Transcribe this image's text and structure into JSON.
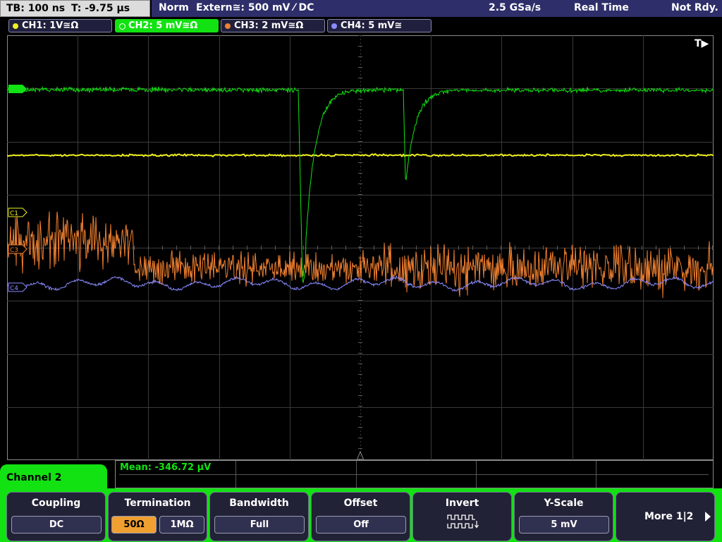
{
  "status": {
    "timebase": "TB: 100 ns",
    "trigger_time": "T: -9.75 µs",
    "mode": "Norm",
    "trigger_source": "Extern≅: 500 mV ⁄ DC",
    "sample_rate": "2.5 GSa/s",
    "acq_mode": "Real Time",
    "ready_state": "Not Rdy."
  },
  "channels": [
    {
      "label": "CH1: 1V≅Ω",
      "color": "#f0f020"
    },
    {
      "label": "CH2: 5 mV≅Ω",
      "color": "#12e212"
    },
    {
      "label": "CH3: 2 mV≅Ω",
      "color": "#f08030"
    },
    {
      "label": "CH4: 5 mV≅",
      "color": "#8a8aff"
    }
  ],
  "markers": {
    "c1": "C1",
    "c3": "C3",
    "c4": "C4",
    "trigger": "T▶"
  },
  "measurement": {
    "label": "Mean: -346.72 µV"
  },
  "menu": {
    "title": "Channel 2",
    "coupling": {
      "title": "Coupling",
      "value": "DC"
    },
    "termination": {
      "title": "Termination",
      "opt1": "50Ω",
      "opt2": "1MΩ"
    },
    "bandwidth": {
      "title": "Bandwidth",
      "value": "Full"
    },
    "offset": {
      "title": "Offset",
      "value": "Off"
    },
    "invert": {
      "title": "Invert"
    },
    "yscale": {
      "title": "Y-Scale",
      "value": "5 mV"
    },
    "more": {
      "label": "More 1|2"
    }
  },
  "colors": {
    "accent": "#12e212",
    "ch1": "#f0f020",
    "ch2": "#12e212",
    "ch3": "#f08030",
    "ch4": "#8a8aff"
  }
}
